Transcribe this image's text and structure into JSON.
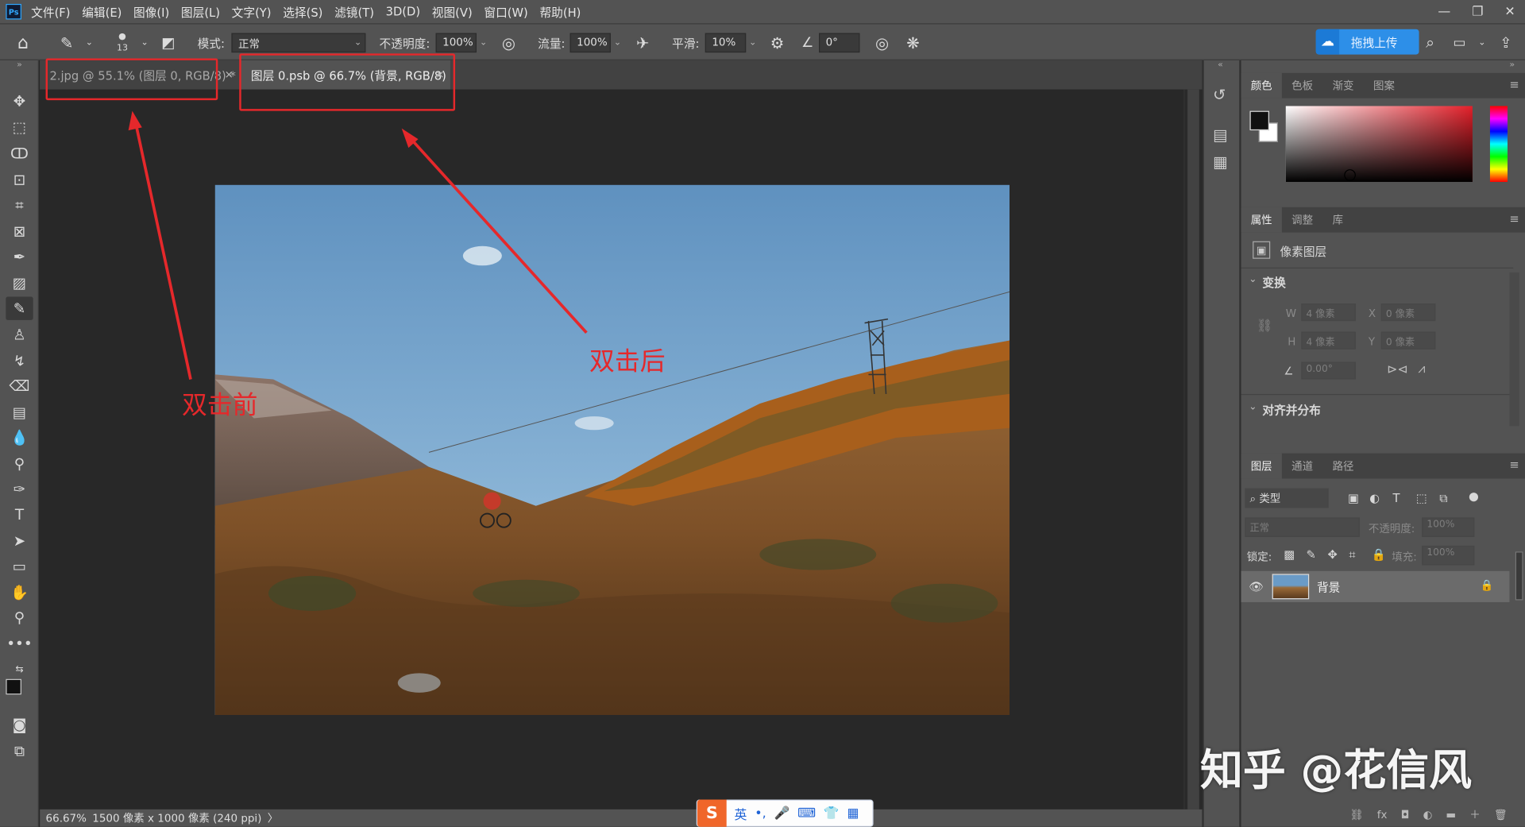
{
  "menu": {
    "logo": "Ps",
    "items": [
      "文件(F)",
      "编辑(E)",
      "图像(I)",
      "图层(L)",
      "文字(Y)",
      "选择(S)",
      "滤镜(T)",
      "3D(D)",
      "视图(V)",
      "窗口(W)",
      "帮助(H)"
    ],
    "win_minimize": "—",
    "win_restore": "❐",
    "win_close": "✕"
  },
  "options": {
    "brush_size": "13",
    "mode_label": "模式:",
    "mode_value": "正常",
    "opacity_label": "不透明度:",
    "opacity_value": "100%",
    "flow_label": "流量:",
    "flow_value": "100%",
    "smooth_label": "平滑:",
    "smooth_value": "10%",
    "angle_value": "0°",
    "upload_label": "拖拽上传"
  },
  "tabs": [
    {
      "label": "2.jpg @ 55.1% (图层 0, RGB/8) *",
      "close": "×"
    },
    {
      "label": "图层 0.psb @ 66.7% (背景, RGB/8)",
      "close": "×"
    }
  ],
  "status": {
    "zoom": "66.67%",
    "doc_info": "1500 像素 x 1000 像素 (240 ppi)",
    "arrow": "〉"
  },
  "annotations": {
    "before": "双击前",
    "after": "双击后"
  },
  "color_panel": {
    "tabs": [
      "颜色",
      "色板",
      "渐变",
      "图案"
    ],
    "colors": {
      "fg": "#111111",
      "bg": "#ffffff",
      "hue": "#e3202a"
    }
  },
  "properties_panel": {
    "tabs": [
      "属性",
      "调整",
      "库"
    ],
    "type_label": "像素图层",
    "transform_label": "变换",
    "w_label": "W",
    "w_value": "4 像素",
    "x_label": "X",
    "x_value": "0 像素",
    "h_label": "H",
    "h_value": "4 像素",
    "y_label": "Y",
    "y_value": "0 像素",
    "angle_value": "0.00°",
    "align_label": "对齐并分布"
  },
  "layers_panel": {
    "tabs": [
      "图层",
      "通道",
      "路径"
    ],
    "filter_value": "类型",
    "blend_value": "正常",
    "opacity_label": "不透明度:",
    "opacity_value": "100%",
    "lock_label": "锁定:",
    "fill_label": "填充:",
    "fill_value": "100%",
    "layer_name": "背景",
    "bottom_icons": [
      "⛓",
      "fx",
      "◘",
      "◐",
      "▬",
      "＋",
      "🗑"
    ]
  },
  "ime": {
    "logo": "S",
    "lang": "英",
    "icons": [
      "•,",
      "🎤",
      "⌨",
      "👕",
      "▦"
    ]
  },
  "watermark": "知乎 @花信风"
}
